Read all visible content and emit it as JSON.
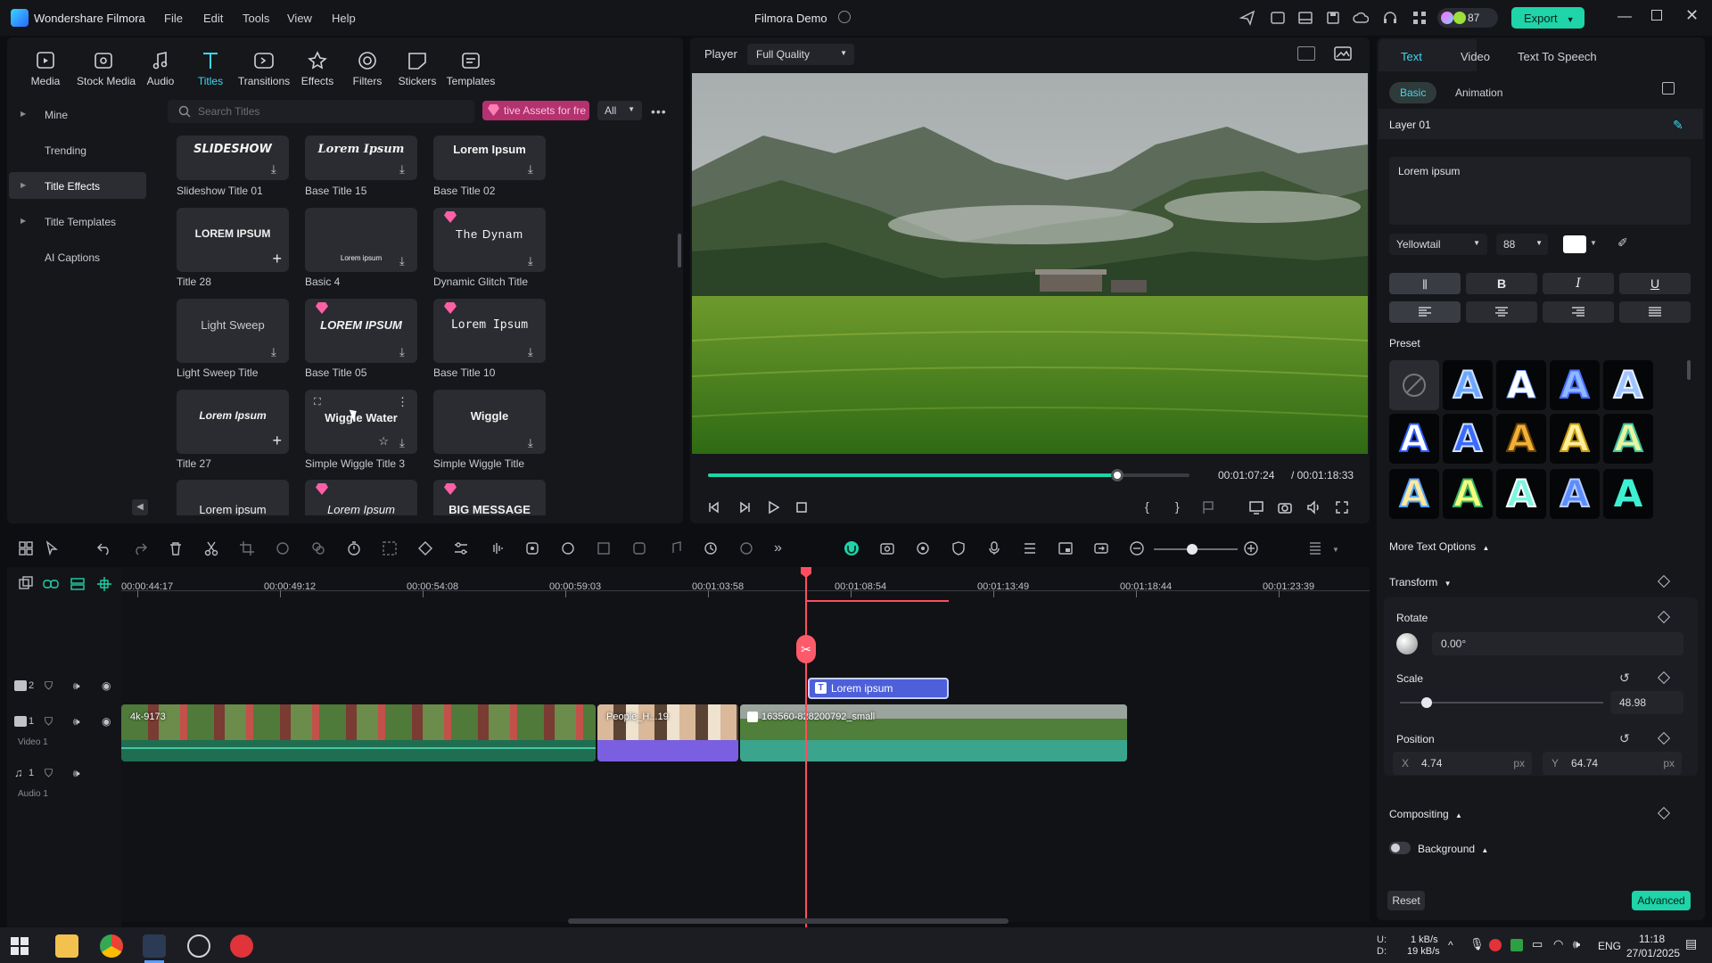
{
  "app": {
    "name": "Wondershare Filmora",
    "menu": [
      "File",
      "Edit",
      "Tools",
      "View",
      "Help"
    ],
    "project_title": "Filmora Demo",
    "credits": "87",
    "export_label": "Export",
    "colors": {
      "accent": "#1ed4a8",
      "cyan": "#3fd6f0",
      "playhead": "#ff4d5e",
      "clip_title": "#4d5fd9"
    }
  },
  "library": {
    "categories": [
      {
        "label": "Media",
        "icon": "media-icon"
      },
      {
        "label": "Stock Media",
        "icon": "stock-media-icon"
      },
      {
        "label": "Audio",
        "icon": "audio-icon"
      },
      {
        "label": "Titles",
        "icon": "titles-icon"
      },
      {
        "label": "Transitions",
        "icon": "transitions-icon"
      },
      {
        "label": "Effects",
        "icon": "effects-icon"
      },
      {
        "label": "Filters",
        "icon": "filters-icon"
      },
      {
        "label": "Stickers",
        "icon": "stickers-icon"
      },
      {
        "label": "Templates",
        "icon": "templates-icon"
      }
    ],
    "sidebar": [
      "Mine",
      "Trending",
      "Title Effects",
      "Title Templates",
      "AI Captions"
    ],
    "search_placeholder": "Search Titles",
    "promo": "tive Assets for fre",
    "filter": "All",
    "cards": [
      {
        "label": "Slideshow Title 01",
        "thumb": "SLIDESHOW"
      },
      {
        "label": "Base Title 15",
        "thumb": "Lorem Ipsum"
      },
      {
        "label": "Base Title 02",
        "thumb": "Lorem Ipsum"
      },
      {
        "label": "Title 28",
        "thumb": "LOREM IPSUM"
      },
      {
        "label": "Basic 4",
        "thumb": "Lorem ipsum"
      },
      {
        "label": "Dynamic Glitch Title",
        "thumb": "The Dynam"
      },
      {
        "label": "Light Sweep Title",
        "thumb": "Light Sweep"
      },
      {
        "label": "Base Title 05",
        "thumb": "LOREM IPSUM"
      },
      {
        "label": "Base Title 10",
        "thumb": "Lorem Ipsum"
      },
      {
        "label": "Title 27",
        "thumb": "Lorem Ipsum"
      },
      {
        "label": "Simple Wiggle Title 3",
        "thumb": "Wiggle Water"
      },
      {
        "label": "Simple Wiggle Title",
        "thumb": "Wiggle"
      },
      {
        "label": "",
        "thumb": "Lorem ipsum"
      },
      {
        "label": "",
        "thumb": "Lorem Ipsum"
      },
      {
        "label": "",
        "thumb": "BIG MESSAGE"
      }
    ]
  },
  "player": {
    "label": "Player",
    "quality": "Full Quality",
    "current_time": "00:01:07:24",
    "total_time": "/ 00:01:18:33",
    "progress": 0.85
  },
  "props": {
    "tabs": [
      "Text",
      "Video",
      "Text To Speech"
    ],
    "subtabs": [
      "Basic",
      "Animation"
    ],
    "layer": "Layer 01",
    "text_value": "Lorem ipsum",
    "font": "Yellowtail",
    "size": "88",
    "format": [
      "B",
      "I",
      "U"
    ],
    "preset_label": "Preset",
    "more_options": "More Text Options",
    "transform": "Transform",
    "rotate_label": "Rotate",
    "rotate_value": "0.00°",
    "scale_label": "Scale",
    "scale_value": "48.98",
    "scale_level": 0.13,
    "position_label": "Position",
    "pos_x_label": "X",
    "pos_x": "4.74",
    "pos_y_label": "Y",
    "pos_y": "64.74",
    "unit": "px",
    "compositing": "Compositing",
    "background": "Background",
    "reset": "Reset",
    "advanced": "Advanced"
  },
  "timeline": {
    "ticks": [
      "00:00:44:17",
      "00:00:49:12",
      "00:00:54:08",
      "00:00:59:03",
      "00:01:03:58",
      "00:01:08:54",
      "00:01:13:49",
      "00:01:18:44",
      "00:01:23:39"
    ],
    "title_clip": "Lorem ipsum",
    "tracks": {
      "video": "Video 1",
      "audio": "Audio 1",
      "v2": "2",
      "v1": "1",
      "a1": "1"
    },
    "clips": [
      "4k-9173",
      "People_H...19",
      "163560-828200792_small"
    ]
  },
  "taskbar": {
    "net_up": "1 kB/s",
    "net_down": "19 kB/s",
    "net_u": "U:",
    "net_d": "D:",
    "lang": "ENG",
    "time": "11:18",
    "date": "27/01/2025"
  }
}
